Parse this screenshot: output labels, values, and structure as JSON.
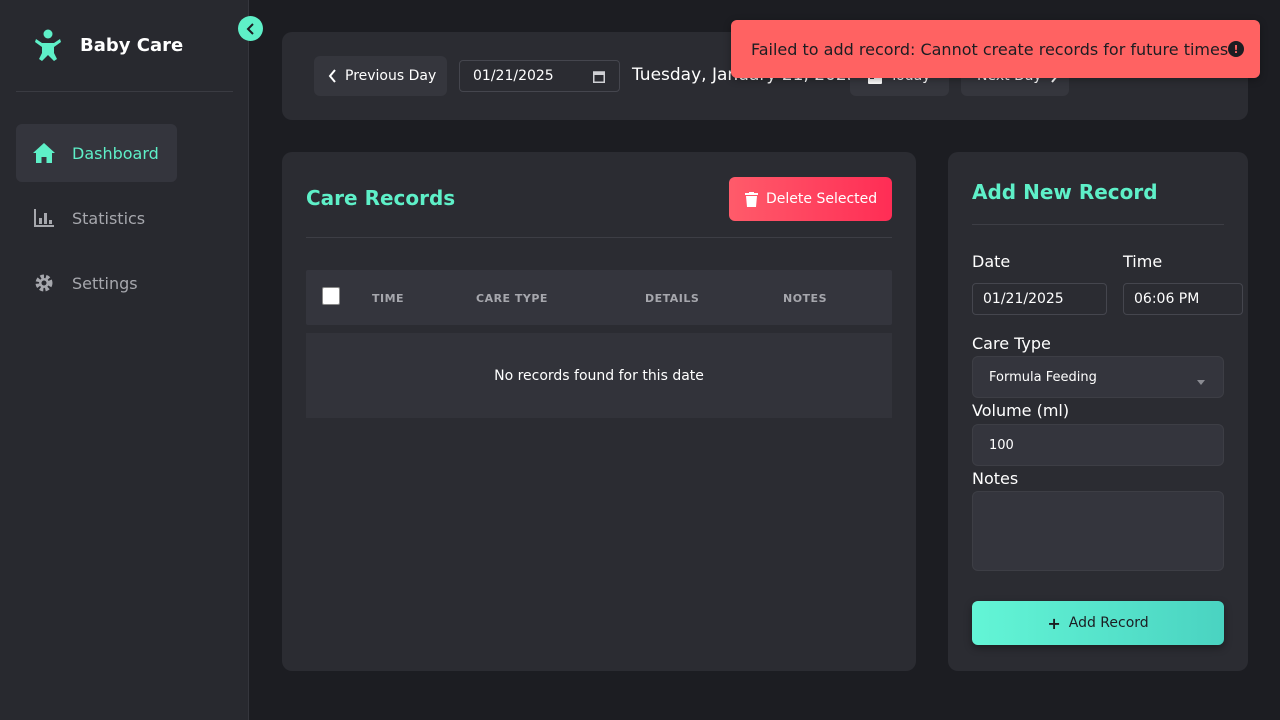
{
  "app": {
    "title": "Baby Care"
  },
  "sidebar": {
    "items": [
      {
        "label": "Dashboard",
        "icon": "home-icon",
        "active": true
      },
      {
        "label": "Statistics",
        "icon": "chart-icon",
        "active": false
      },
      {
        "label": "Settings",
        "icon": "gear-icon",
        "active": false
      }
    ]
  },
  "datebar": {
    "prev_label": "Previous Day",
    "date_value": "01/21/2025",
    "long_date": "Tuesday, January 21, 2025",
    "today_label": "Today",
    "next_label": "Next Day"
  },
  "toast": {
    "message": "Failed to add record: Cannot create records for future times",
    "type": "error"
  },
  "records": {
    "title": "Care Records",
    "delete_label": "Delete Selected",
    "columns": [
      "TIME",
      "CARE TYPE",
      "DETAILS",
      "NOTES"
    ],
    "empty_message": "No records found for this date"
  },
  "form": {
    "title": "Add New Record",
    "date_label": "Date",
    "date_value": "01/21/2025",
    "time_label": "Time",
    "time_value": "06:06 PM",
    "care_type_label": "Care Type",
    "care_type_value": "Formula Feeding",
    "volume_label": "Volume (ml)",
    "volume_value": "100",
    "notes_label": "Notes",
    "notes_value": "",
    "submit_label": "Add Record"
  },
  "colors": {
    "accent": "#5ef0c8",
    "danger": "#ff2d55",
    "toast_bg": "#ff6262",
    "background": "#1c1d22",
    "card": "#2b2c32"
  }
}
